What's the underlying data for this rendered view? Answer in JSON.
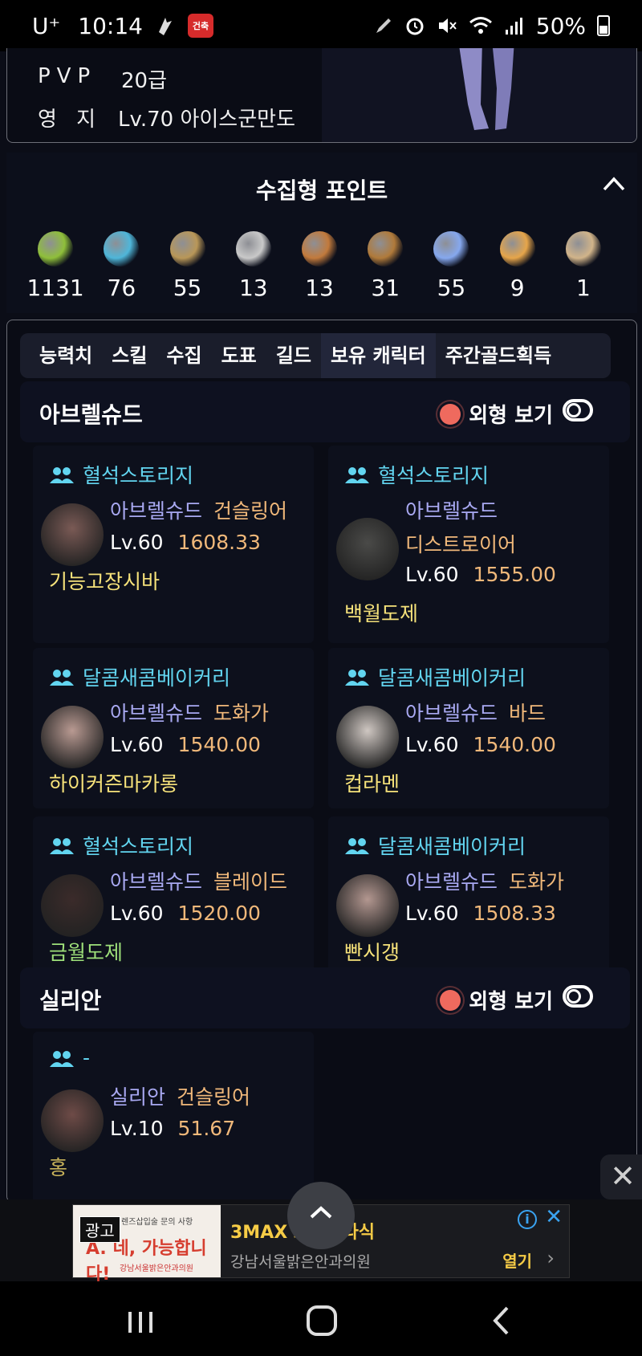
{
  "status_bar": {
    "carrier": "U⁺",
    "time": "10:14",
    "app_badge": "건축",
    "battery": "50%"
  },
  "profile": {
    "rows": [
      {
        "key": "PVP",
        "value": "20급"
      },
      {
        "key": "영 지",
        "value": "Lv.70 아이스군만도"
      }
    ]
  },
  "collection": {
    "title": "수집형 포인트",
    "points": [
      {
        "icon": "mokoko-seed-icon",
        "value": "1131",
        "color": "#8fbf3a"
      },
      {
        "icon": "island-heart-icon",
        "value": "76",
        "color": "#4fb6d9"
      },
      {
        "icon": "map-scroll-icon",
        "value": "55",
        "color": "#b99758"
      },
      {
        "icon": "giant-heart-icon",
        "value": "13",
        "color": "#c9c9c9"
      },
      {
        "icon": "ignea-token-icon",
        "value": "13",
        "color": "#c27a3c"
      },
      {
        "icon": "sea-bounty-icon",
        "value": "31",
        "color": "#b07a3a"
      },
      {
        "icon": "world-tree-leaf-icon",
        "value": "55",
        "color": "#86a8ee"
      },
      {
        "icon": "orpheus-star-icon",
        "value": "9",
        "color": "#e6a54a"
      },
      {
        "icon": "art-icon",
        "value": "1",
        "color": "#d1b48a"
      }
    ]
  },
  "tabs": [
    {
      "label": "능력치",
      "active": false
    },
    {
      "label": "스킬",
      "active": false
    },
    {
      "label": "수집",
      "active": false
    },
    {
      "label": "도표",
      "active": false
    },
    {
      "label": "길드",
      "active": false
    },
    {
      "label": "보유 캐릭터",
      "active": true
    },
    {
      "label": "주간골드획득",
      "active": false
    }
  ],
  "servers": [
    {
      "name": "아브렐슈드",
      "view_label": "외형 보기",
      "characters": [
        {
          "guild": "혈석스토리지",
          "server": "아브렐슈드",
          "class": "건슬링어",
          "level": "Lv.60",
          "item_level": "1608.33",
          "nickname": "기능고장시바",
          "nick_color": "#f6e27a"
        },
        {
          "guild": "혈석스토리지",
          "server": "아브렐슈드",
          "class": "디스트로이어",
          "level": "Lv.60",
          "item_level": "1555.00",
          "nickname": "백월도제",
          "nick_color": "#f6e27a"
        },
        {
          "guild": "달콤새콤베이커리",
          "server": "아브렐슈드",
          "class": "도화가",
          "level": "Lv.60",
          "item_level": "1540.00",
          "nickname": "하이커즌마카롱",
          "nick_color": "#f6e27a"
        },
        {
          "guild": "달콤새콤베이커리",
          "server": "아브렐슈드",
          "class": "바드",
          "level": "Lv.60",
          "item_level": "1540.00",
          "nickname": "컵라멘",
          "nick_color": "#f6e27a"
        },
        {
          "guild": "혈석스토리지",
          "server": "아브렐슈드",
          "class": "블레이드",
          "level": "Lv.60",
          "item_level": "1520.00",
          "nickname": "금월도제",
          "nick_color": "#9ee07a"
        },
        {
          "guild": "달콤새콤베이커리",
          "server": "아브렐슈드",
          "class": "도화가",
          "level": "Lv.60",
          "item_level": "1508.33",
          "nickname": "빤시갱",
          "nick_color": "#f6e27a"
        }
      ]
    },
    {
      "name": "실리안",
      "view_label": "외형 보기",
      "characters": [
        {
          "guild": "-",
          "server": "실리안",
          "class": "건슬링어",
          "level": "Lv.10",
          "item_level": "51.67",
          "nickname": "홍",
          "nick_color": "#c7b25a"
        }
      ]
    }
  ],
  "ad": {
    "badge": "광고",
    "image_line1": "렌즈삽입술 문의 사항",
    "image_headline": "A. 네, 가능합니다!",
    "image_footer": "강남서울밝은안과의원",
    "title": "3MAX 스마일라식",
    "advertiser": "강남서울밝은안과의원",
    "cta": "열기"
  }
}
